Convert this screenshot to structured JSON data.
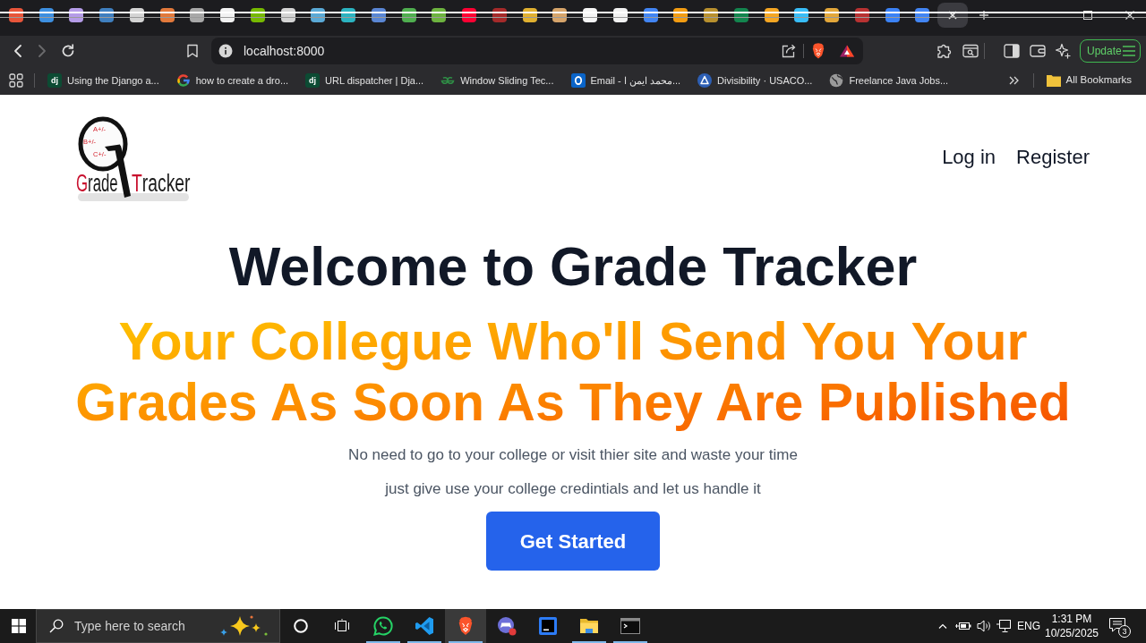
{
  "tabs": [
    {
      "color": "#e8553a",
      "selected": false
    },
    {
      "color": "#3d8fe0",
      "selected": false
    },
    {
      "color": "#b59ce8",
      "selected": false
    },
    {
      "color": "#3f7fbf",
      "selected": false
    },
    {
      "color": "#d4d4d4",
      "selected": false
    },
    {
      "color": "#e2793b",
      "selected": false
    },
    {
      "color": "#a8a8a8",
      "selected": false
    },
    {
      "color": "#f2f2f2",
      "selected": false
    },
    {
      "color": "#76b900",
      "selected": false
    },
    {
      "color": "#d4d4d4",
      "selected": false
    },
    {
      "color": "#5aa9d6",
      "selected": false
    },
    {
      "color": "#2bb3c0",
      "selected": false
    },
    {
      "color": "#5a86d4",
      "selected": false
    },
    {
      "color": "#4fae4f",
      "selected": false
    },
    {
      "color": "#6db33f",
      "selected": false
    },
    {
      "color": "#ff0033",
      "selected": false
    },
    {
      "color": "#a52a2a",
      "selected": false
    },
    {
      "color": "#e0b030",
      "selected": false
    },
    {
      "color": "#d6a46a",
      "selected": false
    },
    {
      "color": "#f5f5f5",
      "selected": false
    },
    {
      "color": "#f2f2f2",
      "selected": false
    },
    {
      "color": "#4285f4",
      "selected": false
    },
    {
      "color": "#f39c12",
      "selected": false
    },
    {
      "color": "#b8902e",
      "selected": false
    },
    {
      "color": "#13854e",
      "selected": false
    },
    {
      "color": "#f5a623",
      "selected": false
    },
    {
      "color": "#38bdf8",
      "selected": false
    },
    {
      "color": "#e3a73a",
      "selected": false
    },
    {
      "color": "#b83232",
      "selected": false
    },
    {
      "color": "#3b82f6",
      "selected": false
    },
    {
      "color": "#4285f4",
      "selected": false
    },
    {
      "selected": true
    }
  ],
  "toolbar": {
    "nav_buttons": [
      {
        "kind": "back",
        "disabled": false
      },
      {
        "kind": "forward",
        "disabled": true
      },
      {
        "kind": "reload",
        "disabled": false
      }
    ],
    "address": "localhost:8000",
    "update_button": "Update"
  },
  "bookmarks_bar": {
    "items": [
      {
        "kind": "letters",
        "badge": "dj",
        "title": "Using the Django a..."
      },
      {
        "kind": "g",
        "title": "how to create a dro..."
      },
      {
        "kind": "letters",
        "badge": "dj",
        "title": "URL dispatcher | Dja..."
      },
      {
        "kind": "arcs",
        "title": "Window Sliding Tec..."
      },
      {
        "kind": "mail",
        "title": "Email - محمد ايمن ا..."
      },
      {
        "kind": "circle",
        "title": "Divisibility · USACO..."
      },
      {
        "kind": "globe",
        "title": "Freelance Java Jobs..."
      }
    ],
    "folder": "All Bookmarks"
  },
  "page": {
    "logo": {
      "grades": [
        "A+/-",
        "B+/-",
        "C+/-"
      ],
      "words": [
        "Grade",
        "Tracker"
      ]
    },
    "nav": [
      "Log in",
      "Register"
    ],
    "heading": "Welcome to Grade Tracker",
    "tagline": "Your Collegue Who'll Send You Your Grades As Soon As They Are Published",
    "lines": [
      "No need to go to your college or visit thier site and waste your time",
      "just give use your college credintials and let us handle it"
    ],
    "button": "Get Started"
  },
  "taskbar": {
    "search_placeholder": "Type here to search",
    "apps": [
      {
        "kind": "chat",
        "running": true,
        "selected": false
      },
      {
        "kind": "code",
        "running": true,
        "selected": false
      },
      {
        "kind": "lion",
        "running": true,
        "selected": true
      },
      {
        "kind": "controller",
        "running": false,
        "selected": false
      },
      {
        "kind": "ide",
        "running": false,
        "selected": false
      },
      {
        "kind": "folder",
        "running": true,
        "selected": false
      },
      {
        "kind": "terminal",
        "running": true,
        "selected": false
      }
    ],
    "language": "ENG",
    "time": "1:31 PM",
    "date": "10/25/2025",
    "notifications": "3"
  }
}
